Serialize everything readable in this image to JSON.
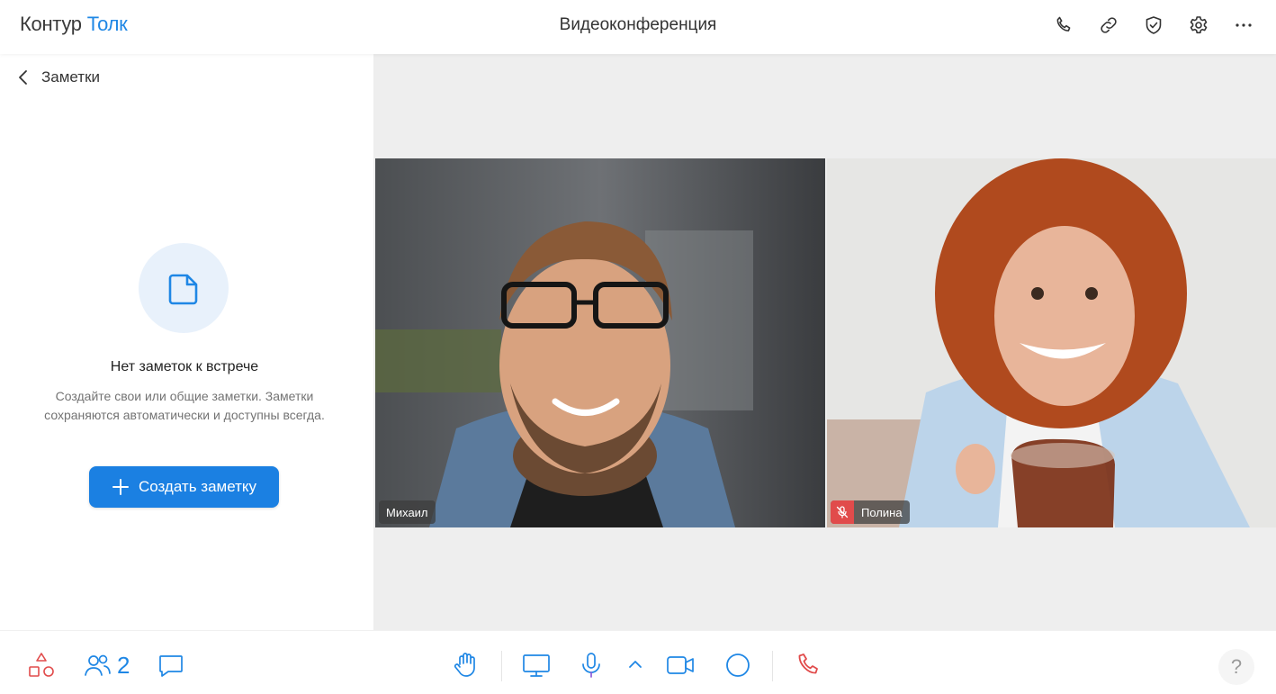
{
  "header": {
    "brand": "Контур",
    "product": "Толк",
    "title": "Видеоконференция",
    "icons": [
      "phone-icon",
      "link-icon",
      "shield-check-icon",
      "gear-icon",
      "more-icon"
    ]
  },
  "sidebar": {
    "back_icon": "chevron-left-icon",
    "title": "Заметки",
    "empty_icon": "document-icon",
    "empty_title": "Нет заметок к встрече",
    "empty_description": "Создайте свои или общие заметки. Заметки сохраняются автоматически и доступны всегда.",
    "create_button": "Создать заметку"
  },
  "participants_tiles": [
    {
      "name": "Михаил",
      "muted": false
    },
    {
      "name": "Полина",
      "muted": true
    }
  ],
  "toolbar": {
    "participants_count": "2",
    "left_icons": [
      "shapes-icon",
      "people-icon",
      "chat-icon"
    ],
    "center_icons": [
      "raise-hand-icon",
      "screen-share-icon",
      "microphone-icon",
      "chevron-up-icon",
      "camera-icon",
      "record-icon",
      "hang-up-icon"
    ],
    "help_label": "?"
  },
  "colors": {
    "accent": "#1f87e5",
    "button": "#1b80e2",
    "danger": "#e14b4b",
    "stage_bg": "#eeeeee"
  }
}
